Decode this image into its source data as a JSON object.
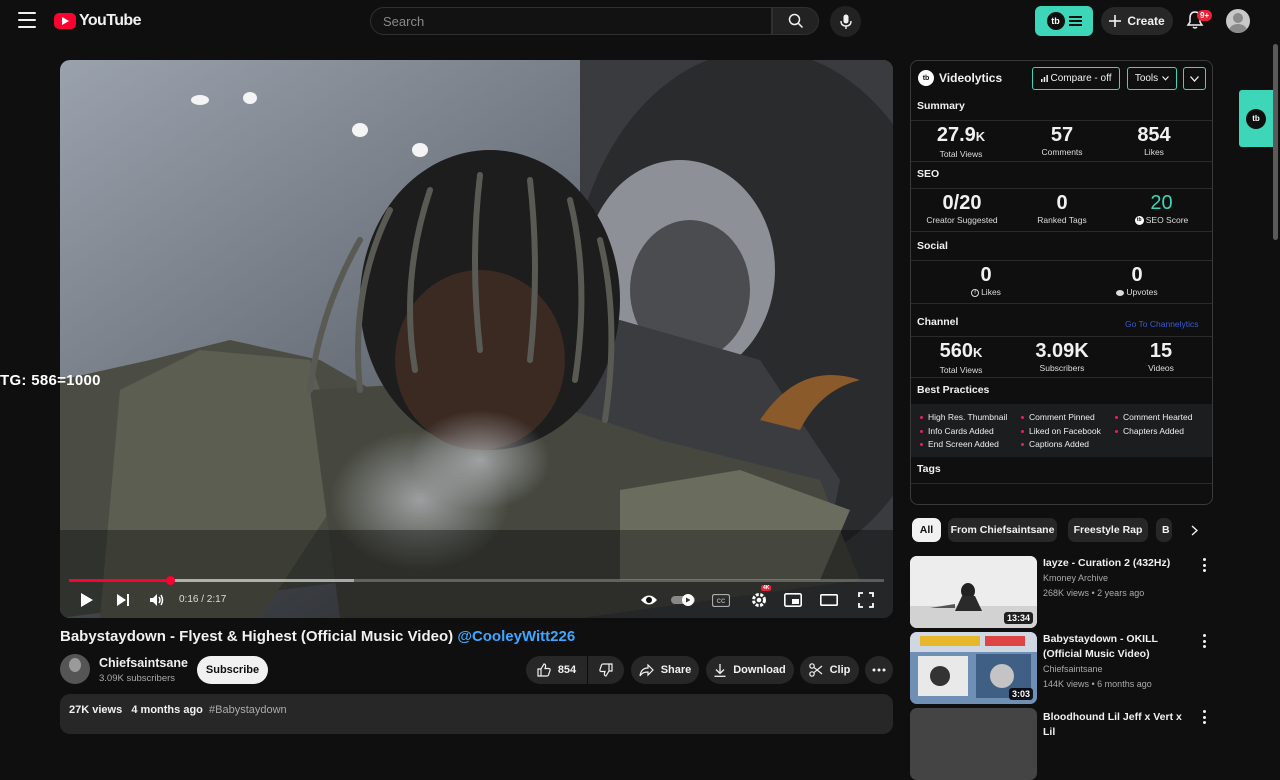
{
  "header": {
    "logo_text": "YouTube",
    "search_placeholder": "Search",
    "create_label": "Create",
    "notifications_badge": "9+"
  },
  "player": {
    "current_time": "0:16",
    "duration": "2:17",
    "time_display": "0:16 / 2:17",
    "progress_fraction": 0.117,
    "settings_badge": "4K",
    "overlay_text": "TG: 586=1000"
  },
  "video": {
    "title": "Babystaydown - Flyest & Highest (Official Music Video)",
    "title_mention": "@CooleyWitt226",
    "channel_name": "Chiefsaintsane",
    "channel_subscribers": "3.09K subscribers",
    "subscribe_label": "Subscribe",
    "likes": "854",
    "share_label": "Share",
    "download_label": "Download",
    "clip_label": "Clip",
    "views": "27K views",
    "age": "4 months ago",
    "hashtag": "#Babystaydown"
  },
  "videolytics": {
    "brand": "Videolytics",
    "compare_label": "Compare - off",
    "tools_label": "Tools",
    "summary": {
      "heading": "Summary",
      "total_views": "27.9",
      "total_views_unit": "K",
      "total_views_label": "Total Views",
      "comments": "57",
      "comments_label": "Comments",
      "likes": "854",
      "likes_label": "Likes"
    },
    "seo": {
      "heading": "SEO",
      "creator_suggested": "0/20",
      "creator_suggested_label": "Creator Suggested",
      "ranked_tags": "0",
      "ranked_tags_label": "Ranked Tags",
      "seo_score": "20",
      "seo_score_label": "SEO Score"
    },
    "social": {
      "heading": "Social",
      "likes": "0",
      "likes_label": "Likes",
      "upvotes": "0",
      "upvotes_label": "Upvotes"
    },
    "channel": {
      "heading": "Channel",
      "link": "Go To Channelytics",
      "total_views": "560",
      "total_views_unit": "K",
      "total_views_label": "Total Views",
      "subscribers": "3.09K",
      "subscribers_label": "Subscribers",
      "videos": "15",
      "videos_label": "Videos"
    },
    "best_practices": {
      "heading": "Best Practices",
      "items": [
        "High Res. Thumbnail",
        "Comment Pinned",
        "Comment Hearted",
        "Info Cards Added",
        "Liked on Facebook",
        "Chapters Added",
        "End Screen Added",
        "Captions Added"
      ]
    },
    "tags_heading": "Tags",
    "accent_color": "#3dd6b8",
    "seo_score_color": "#3dd6b8"
  },
  "chips": [
    "All",
    "From Chiefsaintsane",
    "Freestyle Rap",
    "B"
  ],
  "recommendations": [
    {
      "title": "Iayze - Curation 2 (432Hz)",
      "channel": "Kmoney Archive",
      "meta": "268K views • 2 years ago",
      "duration": "13:34"
    },
    {
      "title": "Babystaydown - OKILL (Official Music Video)",
      "channel": "Chiefsaintsane",
      "meta": "144K views • 6 months ago",
      "duration": "3:03"
    },
    {
      "title": "Bloodhound Lil Jeff x Vert x Lil",
      "channel": "",
      "meta": "",
      "duration": ""
    }
  ],
  "colors": {
    "background": "#0f0f0f",
    "youtube_red": "#ff0033",
    "link_blue": "#3ea6ff"
  }
}
